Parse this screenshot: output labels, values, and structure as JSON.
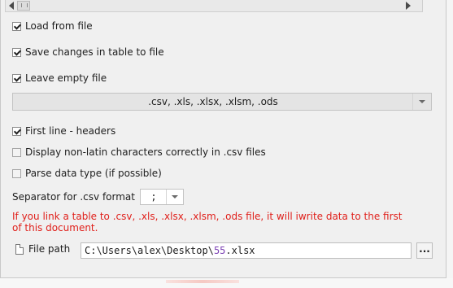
{
  "scrollbar": {
    "left_arrow_icon": "arrow-left-icon",
    "right_arrow_icon": "arrow-right-icon",
    "thumb_icon": "grip-icon"
  },
  "options": {
    "load_from_file": {
      "label": "Load from file",
      "checked": true
    },
    "save_changes": {
      "label": "Save changes in table to file",
      "checked": true
    },
    "leave_empty": {
      "label": "Leave empty file",
      "checked": true
    },
    "formats_select": {
      "value": ".csv, .xls, .xlsx, .xlsm, .ods"
    },
    "first_line_headers": {
      "label": "First line - headers",
      "checked": true
    },
    "non_latin": {
      "label": "Display non-latin characters correctly in .csv files",
      "checked": false
    },
    "parse_types": {
      "label": "Parse data type (if possible)",
      "checked": false
    }
  },
  "separator": {
    "label": "Separator for .csv format",
    "value": ";"
  },
  "warning": {
    "text": "If you link a table to .csv, .xls, .xlsx, .xlsm, .ods file, it will iwrite data to the first of this document.",
    "color": "#e0201b"
  },
  "file_path": {
    "label": "File path",
    "value_prefix": "C:\\Users\\alex\\Desktop\\",
    "value_number": "55",
    "value_suffix": ".xlsx",
    "browse_label": "..."
  }
}
